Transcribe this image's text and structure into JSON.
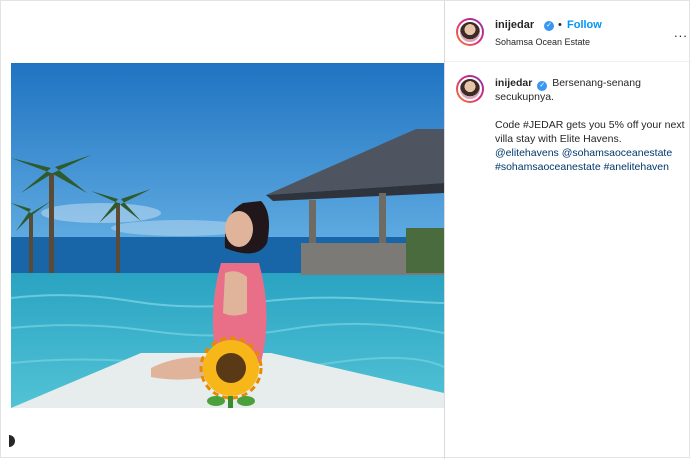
{
  "post": {
    "username": "inijedar",
    "follow_label": "Follow",
    "separator": "•",
    "location": "Sohamsa Ocean Estate",
    "more_label": "..."
  },
  "caption": {
    "username": "inijedar",
    "text_line1": "Bersenang-senang",
    "text_line2": "secukupnya.",
    "promo": "Code #JEDAR gets you 5% off your next villa stay with Elite Havens.",
    "mentions": "@elitehavens @sohamsaoceanestate",
    "hashtags": "#sohamsaoceanestate #anelitehaven"
  },
  "icons": {
    "verified": "verified-badge-icon",
    "more": "more-options-icon",
    "sticker": "sunflower-sticker-icon"
  },
  "colors": {
    "link": "#00376b",
    "follow": "#0095f6",
    "verified": "#3897f0",
    "sky": "#2d86c6",
    "pool": "#3fb8cf"
  }
}
